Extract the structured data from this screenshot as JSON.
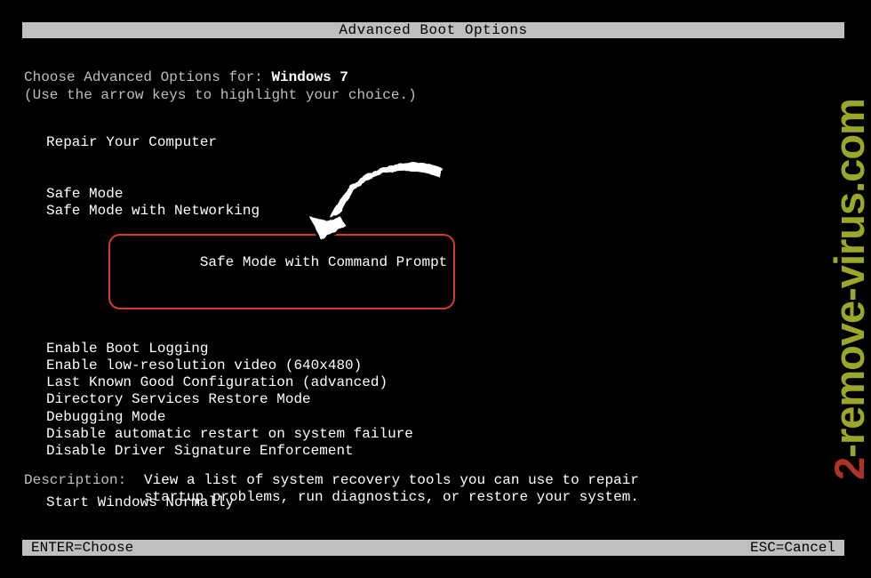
{
  "titlebar": "Advanced Boot Options",
  "choose_prefix": "Choose Advanced Options for: ",
  "os_name": "Windows 7",
  "hint": "(Use the arrow keys to highlight your choice.)",
  "menu": {
    "repair": "Repair Your Computer",
    "safe": "Safe Mode",
    "safe_net": "Safe Mode with Networking",
    "safe_cmd": "Safe Mode with Command Prompt",
    "bootlog": "Enable Boot Logging",
    "lowres": "Enable low-resolution video (640x480)",
    "lkgc": "Last Known Good Configuration (advanced)",
    "dsrm": "Directory Services Restore Mode",
    "debug": "Debugging Mode",
    "noauto": "Disable automatic restart on system failure",
    "nosig": "Disable Driver Signature Enforcement",
    "normal": "Start Windows Normally"
  },
  "desc_label": "Description:",
  "desc_text": "View a list of system recovery tools you can use to repair startup problems, run diagnostics, or restore your system.",
  "footer": {
    "enter": "ENTER=Choose",
    "esc": "ESC=Cancel"
  },
  "watermark": {
    "num": "2",
    "text": "-remove-virus.com"
  }
}
